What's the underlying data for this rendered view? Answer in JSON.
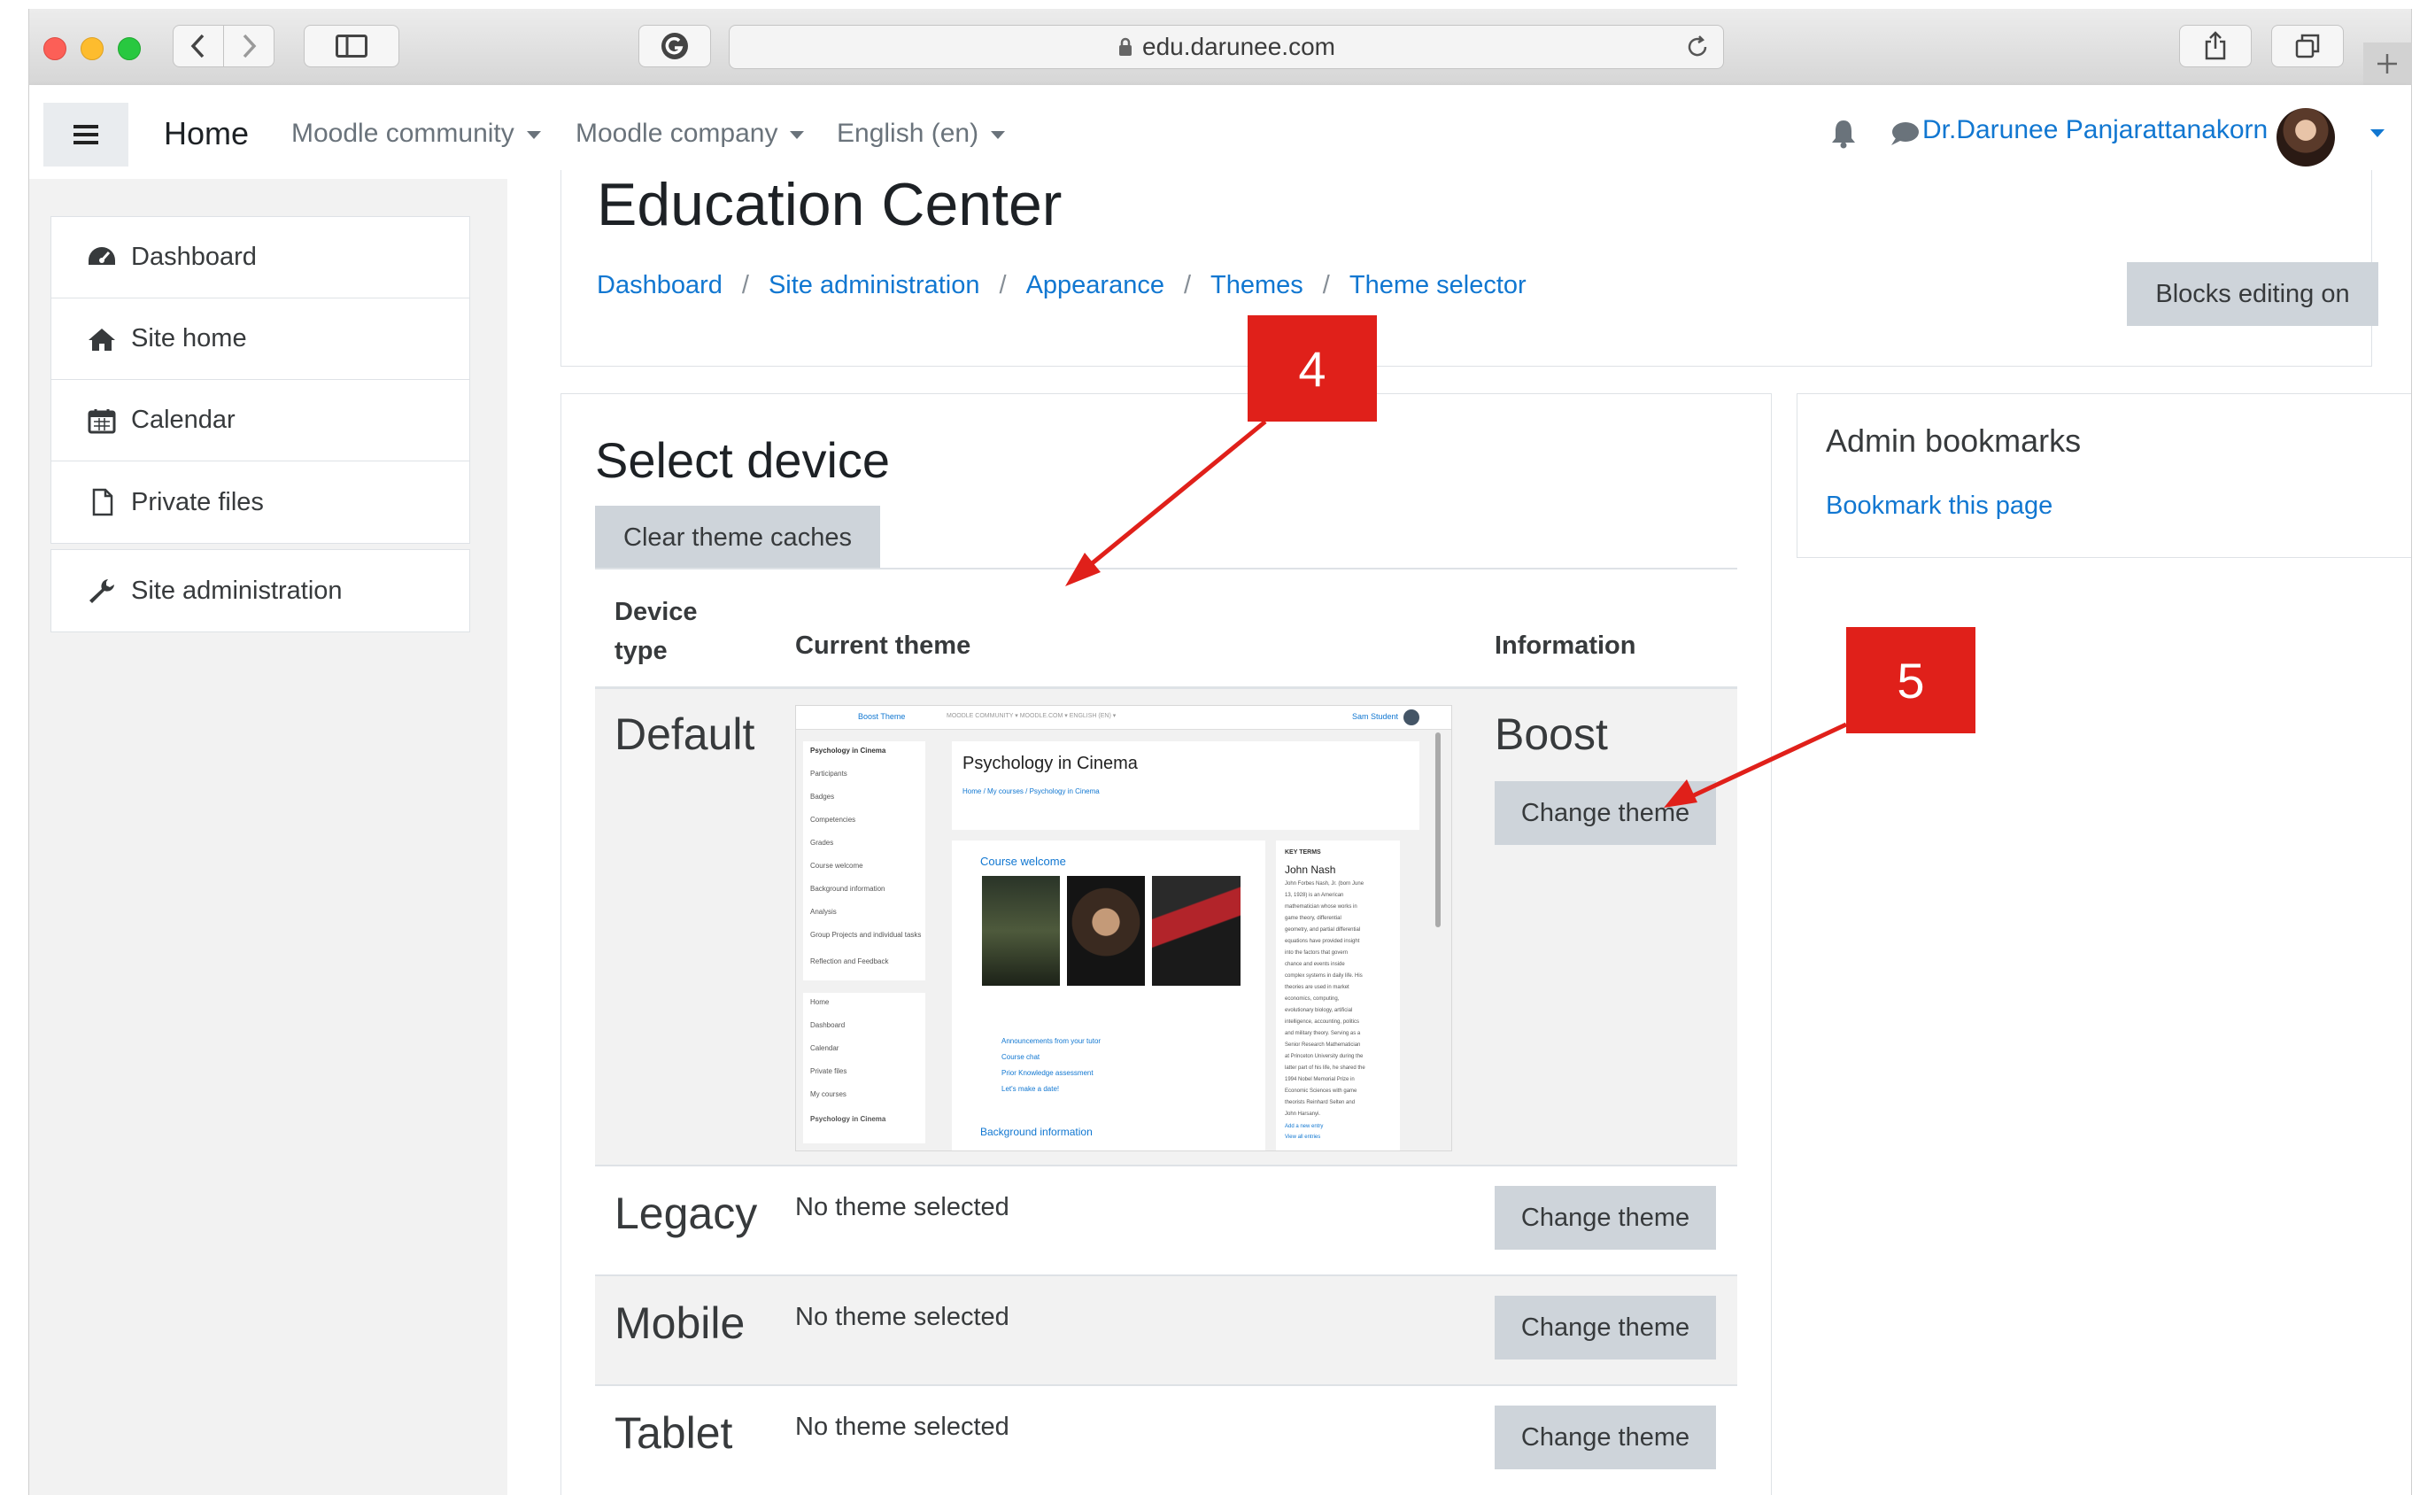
{
  "browser": {
    "url": "edu.darunee.com"
  },
  "navbar": {
    "home": "Home",
    "menus": [
      "Moodle community",
      "Moodle company",
      "English (en)"
    ],
    "user_name": "Dr.Darunee Panjarattanakorn"
  },
  "drawer": {
    "items": [
      "Dashboard",
      "Site home",
      "Calendar",
      "Private files"
    ],
    "admin": "Site administration"
  },
  "header": {
    "title": "Education Center",
    "breadcrumb": [
      "Dashboard",
      "Site administration",
      "Appearance",
      "Themes",
      "Theme selector"
    ],
    "blocks_button": "Blocks editing on"
  },
  "main": {
    "heading": "Select device",
    "clear_button": "Clear theme caches",
    "columns": {
      "device_line1": "Device",
      "device_line2": "type",
      "current": "Current theme",
      "info": "Information"
    },
    "rows": [
      {
        "device": "Default",
        "theme_name": "Boost",
        "button": "Change theme"
      },
      {
        "device": "Legacy",
        "current": "No theme selected",
        "button": "Change theme"
      },
      {
        "device": "Mobile",
        "current": "No theme selected",
        "button": "Change theme"
      },
      {
        "device": "Tablet",
        "current": "No theme selected",
        "button": "Change theme"
      }
    ]
  },
  "sidebar_block": {
    "title": "Admin bookmarks",
    "link": "Bookmark this page"
  },
  "callouts": {
    "four": "4",
    "five": "5"
  },
  "preview": {
    "brand": "Boost Theme",
    "top_links": "MOODLE COMMUNITY ▾   MOODLE.COM ▾   ENGLISH (EN) ▾",
    "user": "Sam Student",
    "course_title": "Psychology in Cinema",
    "crumb": "Home / My courses / Psychology in Cinema",
    "nav_items": [
      "Psychology in Cinema",
      "Participants",
      "Badges",
      "Competencies",
      "Grades",
      "Course welcome",
      "Background information",
      "Analysis",
      "Group Projects and individual tasks",
      "Reflection and Feedback"
    ],
    "nav_items2": [
      "Home",
      "Dashboard",
      "Calendar",
      "Private files",
      "My courses",
      "Psychology in Cinema"
    ],
    "section_title": "Course welcome",
    "activities": [
      "Announcements from your tutor",
      "Course chat",
      "Prior Knowledge assessment",
      "Let's make a date!"
    ],
    "section2": "Background information",
    "terms_head": "KEY TERMS",
    "terms_name": "John Nash",
    "terms_text": [
      "John Forbes Nash, Jr. (born June",
      "13, 1928) is an American",
      "mathematician whose works in",
      "game theory, differential",
      "geometry, and partial differential",
      "equations have provided insight",
      "into the factors that govern",
      "chance and events inside",
      "complex systems in daily life. His",
      "theories are used in market",
      "economics, computing,",
      "evolutionary biology, artificial",
      "intelligence, accounting, politics",
      "and military theory. Serving as a",
      "Senior Research Mathematician",
      "at Princeton University during the",
      "latter part of his life, he shared the",
      "1994 Nobel Memorial Prize in",
      "Economic Sciences with game",
      "theorists Reinhard Selten and",
      "John Harsanyi."
    ],
    "terms_links": [
      "Add a new entry",
      "View all entries"
    ]
  },
  "colors": {
    "link": "#1177d1",
    "callout": "#e0201a",
    "button": "#ced4da"
  }
}
